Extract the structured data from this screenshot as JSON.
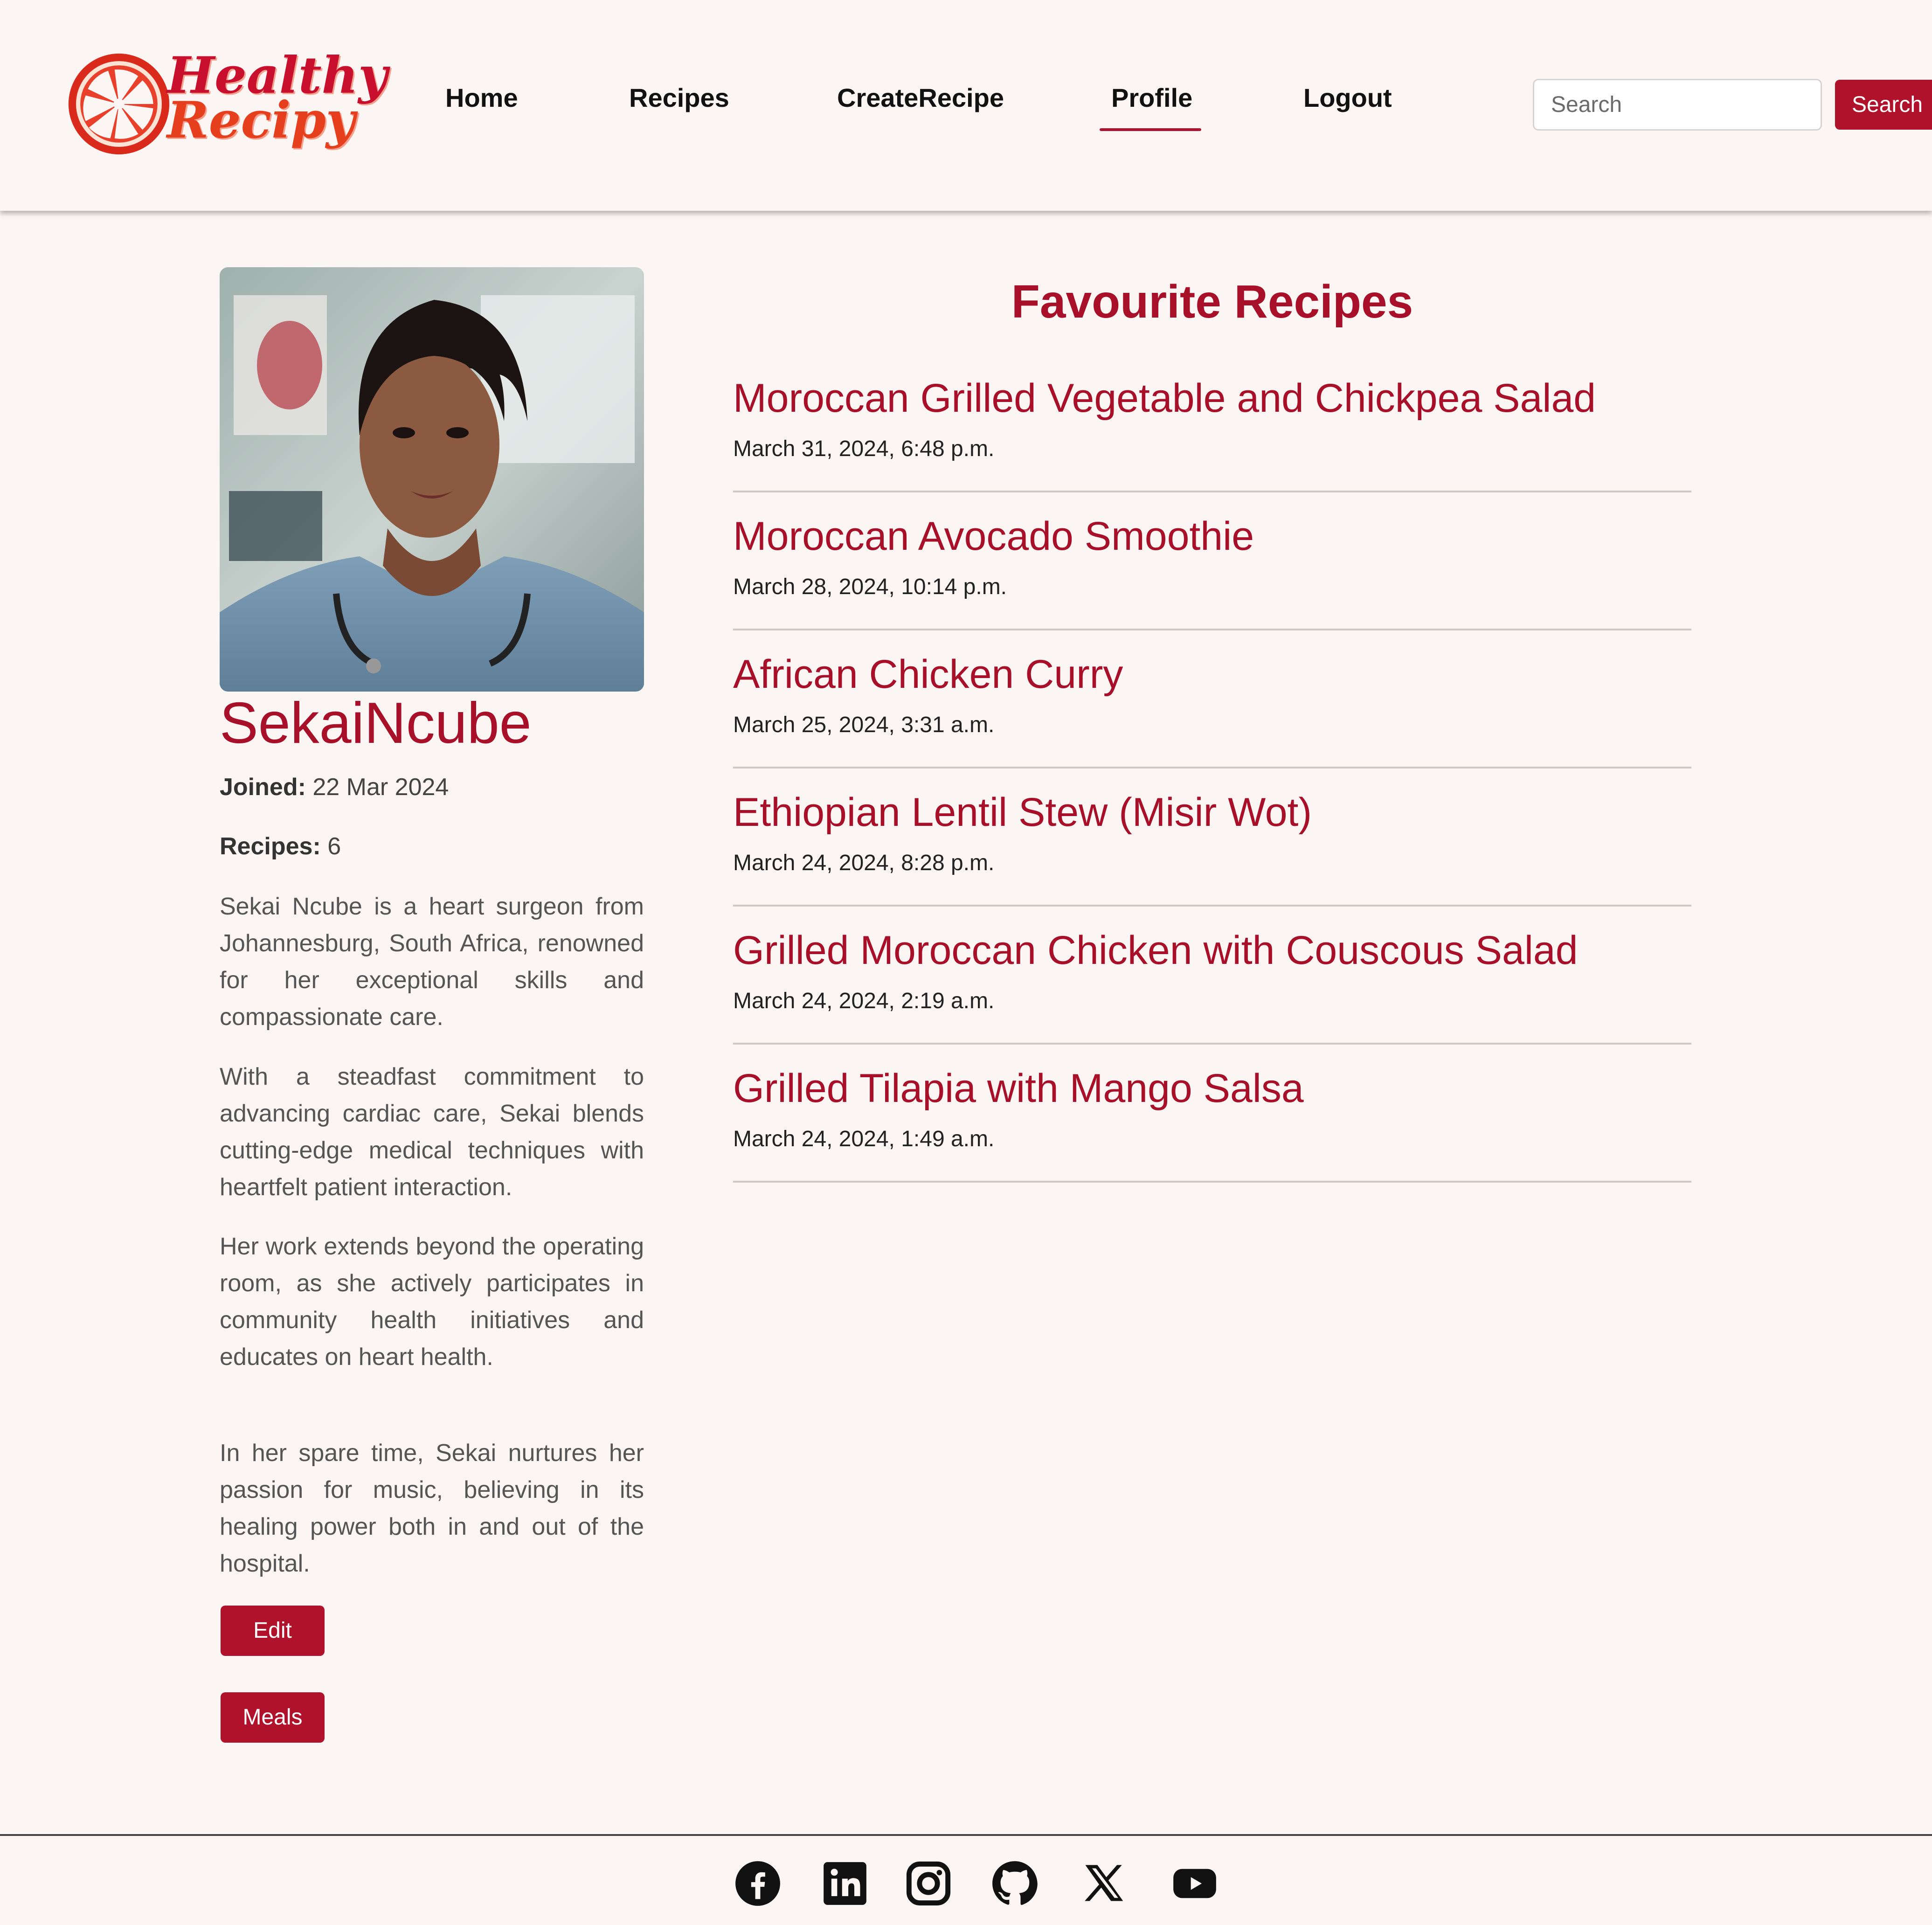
{
  "header": {
    "logo_line1": "Healthy",
    "logo_line2": "Recipy",
    "nav": {
      "home": "Home",
      "recipes": "Recipes",
      "create": "CreateRecipe",
      "profile": "Profile",
      "logout": "Logout"
    },
    "active_nav": "Profile",
    "search_placeholder": "Search",
    "search_button": "Search"
  },
  "profile": {
    "username": "SekaiNcube",
    "joined_label": "Joined:",
    "joined_value": "22 Mar 2024",
    "recipes_label": "Recipes:",
    "recipes_value": "6",
    "bio": [
      "Sekai Ncube is a heart surgeon from Johannesburg, South Africa, renowned for her exceptional skills and compassionate care.",
      "With a steadfast commitment to advancing cardiac care, Sekai blends cutting-edge medical techniques with heartfelt patient interaction.",
      "Her work extends beyond the operating room, as she actively participates in community health initiatives and educates on heart health.",
      "In her spare time, Sekai nurtures her passion for music, believing in its healing power both in and out of the hospital."
    ],
    "edit_button": "Edit",
    "meals_button": "Meals"
  },
  "favourites": {
    "title": "Favourite Recipes",
    "items": [
      {
        "name": "Moroccan Grilled Vegetable and Chickpea Salad",
        "date": "March 31, 2024, 6:48 p.m."
      },
      {
        "name": "Moroccan Avocado Smoothie",
        "date": "March 28, 2024, 10:14 p.m."
      },
      {
        "name": "African Chicken Curry",
        "date": "March 25, 2024, 3:31 a.m."
      },
      {
        "name": "Ethiopian Lentil Stew (Misir Wot)",
        "date": "March 24, 2024, 8:28 p.m."
      },
      {
        "name": "Grilled Moroccan Chicken with Couscous Salad",
        "date": "March 24, 2024, 2:19 a.m."
      },
      {
        "name": "Grilled Tilapia with Mango Salsa",
        "date": "March 24, 2024, 1:49 a.m."
      }
    ]
  },
  "footer": {
    "icons": [
      "facebook-icon",
      "linkedin-icon",
      "instagram-icon",
      "github-icon",
      "x-icon",
      "youtube-icon"
    ]
  },
  "colors": {
    "brand": "#b0112b",
    "background": "#fbf6f4",
    "logo_orange": "#e53f1e"
  }
}
